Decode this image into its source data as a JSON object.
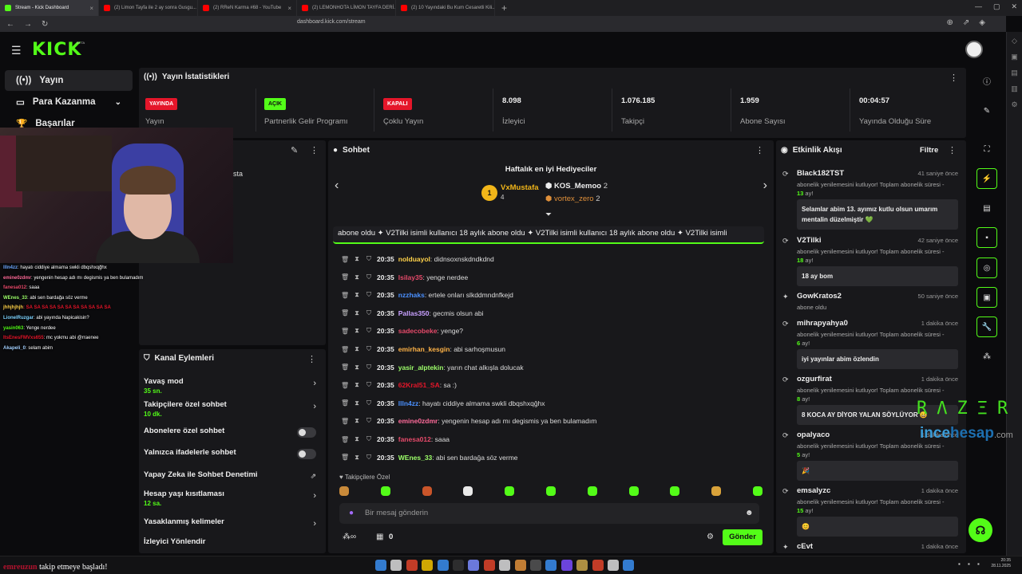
{
  "browser": {
    "tabs": [
      {
        "label": "Stream - Kick Dashboard",
        "active": true,
        "color": "#53fc18"
      },
      {
        "label": "(2) Limon Tayfa ile 2 ay sonra Gusgu...",
        "color": "#ff0000"
      },
      {
        "label": "(2) RReN Karma #68 - YouTube",
        "color": "#ff0000"
      },
      {
        "label": "(2) LEMONHOTA LİMON TAYFA DERİ...",
        "color": "#ff0000"
      },
      {
        "label": "(2) 10 Yayındaki Bu Kum Cesaretli Kili...",
        "color": "#ff0000"
      }
    ],
    "url": "dashboard.kick.com/stream"
  },
  "brand": {
    "logo": "KICK",
    "beta": "BETA",
    "accent": "#53fc18"
  },
  "leftnav": {
    "items": [
      {
        "label": "Yayın",
        "icon": "broadcast-icon"
      },
      {
        "label": "Para Kazanma",
        "icon": "wallet-icon"
      },
      {
        "label": "Başarılar",
        "icon": "trophy-icon"
      }
    ]
  },
  "stats": {
    "title": "Yayın İstatistikleri",
    "items": [
      {
        "badge": "YAYINDA",
        "label": "Yayın",
        "badge_color": "#e5162a"
      },
      {
        "badge": "AÇIK",
        "label": "Partnerlik Gelir Programı",
        "badge_color": "#53fc18"
      },
      {
        "badge": "KAPALI",
        "label": "Çoklu Yayın",
        "badge_color": "#e5162a"
      },
      {
        "value": "8.098",
        "label": "İzleyici"
      },
      {
        "value": "1.076.185",
        "label": "Takipçi"
      },
      {
        "value": "1.959",
        "label": "Abone Sayısı"
      },
      {
        "value": "00:04:57",
        "label": "Yayında Olduğu Süre"
      }
    ]
  },
  "stream_panel": {
    "partial_text": "sta"
  },
  "overlay_chat": [
    {
      "user": "llln4zz",
      "text": ": hayatı ciddiye almama swkli dbqshxqğhx",
      "color": "#6ea8ff"
    },
    {
      "user": "emine0zdmr",
      "text": ": yengenin hesap adı mı degismis ya ben bulamadım",
      "color": "#ff6b9a"
    },
    {
      "user": "fanesa012",
      "text": ": saaa",
      "color": "#e64a6a"
    },
    {
      "user": "WEnes_33",
      "text": ": abi sen bardağa söz verme",
      "color": "#9dff6a"
    },
    {
      "user": "jhhjhjhjh",
      "text": ": SA SA SA SA SA SA SA SA SA SA SA",
      "color": "#ffd24a"
    },
    {
      "user": "LionelRuzgar",
      "text": ": abi yayında Napicakisin?",
      "color": "#7dd3ff"
    },
    {
      "user": "yasin063",
      "text": ": Yenge nerdee",
      "color": "#53fc18"
    },
    {
      "user": "ItsEnesFMVxs655",
      "text": ": mc yokmu abi @rraenee",
      "color": "#e5162a"
    },
    {
      "user": "Akapeli_0",
      "text": ": selam abim",
      "color": "#a3d0ff"
    }
  ],
  "channel_actions": {
    "title": "Kanal Eylemleri",
    "items": [
      {
        "label": "Yavaş mod",
        "sub": "35 sn.",
        "kind": "arrow"
      },
      {
        "label": "Takipçilere özel sohbet",
        "sub": "10 dk.",
        "kind": "arrow"
      },
      {
        "label": "Abonelere özel sohbet",
        "kind": "toggle"
      },
      {
        "label": "Yalnızca ifadelerle sohbet",
        "kind": "toggle"
      },
      {
        "label": "Yapay Zeka ile Sohbet Denetimi",
        "kind": "external"
      },
      {
        "label": "Hesap yaşı kısıtlaması",
        "sub": "12 sa.",
        "kind": "arrow"
      },
      {
        "label": "Yasaklanmış kelimeler",
        "kind": "arrow"
      },
      {
        "label": "İzleyici Yönlendir",
        "kind": "none"
      }
    ]
  },
  "chat": {
    "title": "Sohbet",
    "gifters_title": "Haftalık en iyi Hediyeciler",
    "gifters": [
      {
        "name": "VxMustafa",
        "count": "4",
        "rank": "1"
      },
      {
        "name": "KOS_Memoo",
        "count": "2"
      },
      {
        "name": "vortex_zero",
        "count": "2"
      }
    ],
    "ticker": "abone oldu ✦ V2Tilki isimli kullanıcı 18 aylık abone oldu ✦ V2Tilki isimli kullanıcı 18 aylık abone oldu ✦ V2Tilki isimli",
    "messages": [
      {
        "time": "20:35",
        "user": "nolduayol",
        "text": ": didnsoxnskdndkdnd",
        "color": "#ffd24a"
      },
      {
        "time": "20:35",
        "user": "lsilay35",
        "text": ": yenge nerdee",
        "color": "#e64a6a"
      },
      {
        "time": "20:35",
        "user": "nzzhaks",
        "text": ": ertele onları slkddmndnfkejd",
        "color": "#4a90ff"
      },
      {
        "time": "20:35",
        "user": "Pallas350",
        "text": ": gecmis olsun abi",
        "color": "#c8a0ff"
      },
      {
        "time": "20:35",
        "user": "sadecobeke",
        "text": ": yenge?",
        "color": "#e64a6a"
      },
      {
        "time": "20:35",
        "user": "emirhan_kesgin",
        "text": ": abi sarhoşmusun",
        "color": "#ffb347"
      },
      {
        "time": "20:35",
        "user": "yasir_alptekin",
        "text": ": yarın chat alkışla dolucak",
        "color": "#9dff6a"
      },
      {
        "time": "20:35",
        "user": "62Kral51_SA",
        "text": ": sa :)",
        "color": "#e5162a"
      },
      {
        "time": "20:35",
        "user": "llln4zz",
        "text": ": hayatı ciddiye almama swkli dbqshxqğhx",
        "color": "#4a90ff"
      },
      {
        "time": "20:35",
        "user": "emine0zdmr",
        "text": ": yengenin hesap adı mı degismis ya ben bulamadım",
        "color": "#ff6b9a"
      },
      {
        "time": "20:35",
        "user": "fanesa012",
        "text": ": saaa",
        "color": "#e64a6a"
      },
      {
        "time": "20:35",
        "user": "WEnes_33",
        "text": ": abi sen bardağa söz verme",
        "color": "#9dff6a"
      }
    ],
    "followers_only_label": "Takipçilere Özel",
    "input_placeholder": "Bir mesaj gönderin",
    "points": "0",
    "send_label": "Gönder"
  },
  "feed": {
    "title": "Etkinlik Akışı",
    "filter_label": "Filtre",
    "items": [
      {
        "name": "Black182TST",
        "time": "41 saniye önce",
        "desc": "abonelik yenilemesini kutluyor! Toplam abonelik süresi - ",
        "months": "13",
        "suffix": " ay!",
        "msg": "Selamlar abim 13. ayımız kutlu olsun umarım mentalin düzelmiştir 💚"
      },
      {
        "name": "V2Tilki",
        "time": "42 saniye önce",
        "desc": "abonelik yenilemesini kutluyor! Toplam abonelik süresi - ",
        "months": "18",
        "suffix": " ay!",
        "msg": "18 ay bom"
      },
      {
        "name": "GowKratos2",
        "time": "50 saniye önce",
        "desc": "abone oldu"
      },
      {
        "name": "mihrapyahya0",
        "time": "1 dakika önce",
        "desc": "abonelik yenilemesini kutluyor! Toplam abonelik süresi - ",
        "months": "6",
        "suffix": " ay!",
        "msg": "iyi yayınlar abim özlendin"
      },
      {
        "name": "ozgurfirat",
        "time": "1 dakika önce",
        "desc": "abonelik yenilemesini kutluyor! Toplam abonelik süresi - ",
        "months": "8",
        "suffix": " ay!",
        "msg": "8 KOCA AY DİYOR YALAN SÖYLÜYOR 😅"
      },
      {
        "name": "opalyaco",
        "time": "1 dakika önce",
        "desc": "abonelik yenilemesini kutluyor! Toplam abonelik süresi - ",
        "months": "5",
        "suffix": " ay!",
        "msg": "🎉"
      },
      {
        "name": "emsalyzc",
        "time": "1 dakika önce",
        "desc": "abonelik yenilemesini kutluyor! Toplam abonelik süresi - ",
        "months": "15",
        "suffix": " ay!",
        "msg": "😊"
      },
      {
        "name": "cEvt",
        "time": "1 dakika önce"
      }
    ]
  },
  "overlays": {
    "razer": "RΛZΞR",
    "watermark_a": "ince",
    "watermark_b": "hesap",
    "watermark_c": ".com",
    "follow_user": "emreuzun",
    "follow_text": " takip etmeye başladı!"
  },
  "clock": {
    "time": "20:35",
    "date": "28.11.2025"
  }
}
